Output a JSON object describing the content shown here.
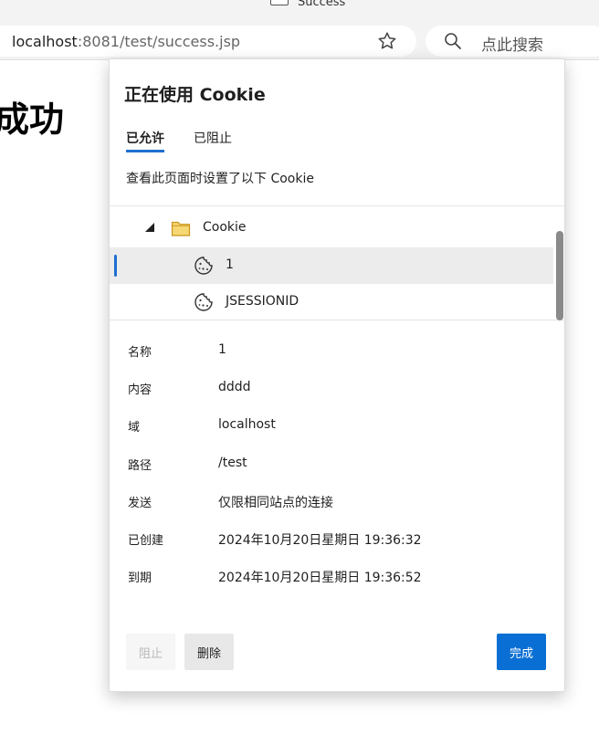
{
  "browser": {
    "tab_title": "Success",
    "address": {
      "host": "localhost",
      "rest": ":8081/test/success.jsp"
    },
    "search_placeholder": "点此搜索"
  },
  "page": {
    "heading": "成功"
  },
  "cookie_popup": {
    "title": "正在使用 Cookie",
    "tabs": [
      {
        "label": "已允许",
        "active": true
      },
      {
        "label": "已阻止",
        "active": false
      }
    ],
    "description": "查看此页面时设置了以下 Cookie",
    "tree": {
      "folder": "Cookie",
      "items": [
        {
          "label": "1",
          "selected": true
        },
        {
          "label": "JSESSIONID",
          "selected": false
        }
      ]
    },
    "details": [
      {
        "label": "名称",
        "value": "1"
      },
      {
        "label": "内容",
        "value": "dddd"
      },
      {
        "label": "域",
        "value": "localhost"
      },
      {
        "label": "路径",
        "value": "/test"
      },
      {
        "label": "发送",
        "value": "仅限相同站点的连接"
      },
      {
        "label": "已创建",
        "value": "2024年10月20日星期日 19:36:32"
      },
      {
        "label": "到期",
        "value": "2024年10月20日星期日 19:36:52"
      }
    ],
    "buttons": {
      "block": "阻止",
      "delete": "删除",
      "done": "完成"
    }
  },
  "colors": {
    "accent": "#0a6fd4",
    "selection": "#ececec",
    "folder": "#f2c94c"
  },
  "icons": {
    "favorite": "star-icon",
    "search": "search-icon",
    "folder": "folder-icon",
    "cookie": "cookie-icon",
    "collapse": "triangle-down-icon"
  }
}
